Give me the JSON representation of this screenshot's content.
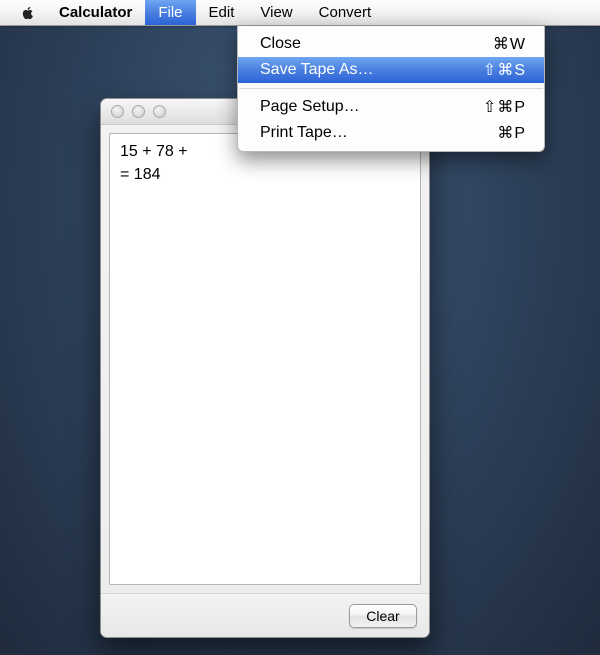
{
  "menubar": {
    "app_name": "Calculator",
    "items": [
      {
        "label": "File",
        "active": true
      },
      {
        "label": "Edit",
        "active": false
      },
      {
        "label": "View",
        "active": false
      },
      {
        "label": "Convert",
        "active": false
      }
    ]
  },
  "file_menu": {
    "items": [
      {
        "label": "Close",
        "shortcut": "⌘W",
        "highlighted": false
      },
      {
        "label": "Save Tape As…",
        "shortcut": "⇧⌘S",
        "highlighted": true
      },
      {
        "type": "separator"
      },
      {
        "label": "Page Setup…",
        "shortcut": "⇧⌘P",
        "highlighted": false
      },
      {
        "label": "Print Tape…",
        "shortcut": "⌘P",
        "highlighted": false
      }
    ]
  },
  "tape_window": {
    "lines": [
      "15 + 78 +",
      "= 184"
    ],
    "clear_label": "Clear"
  }
}
